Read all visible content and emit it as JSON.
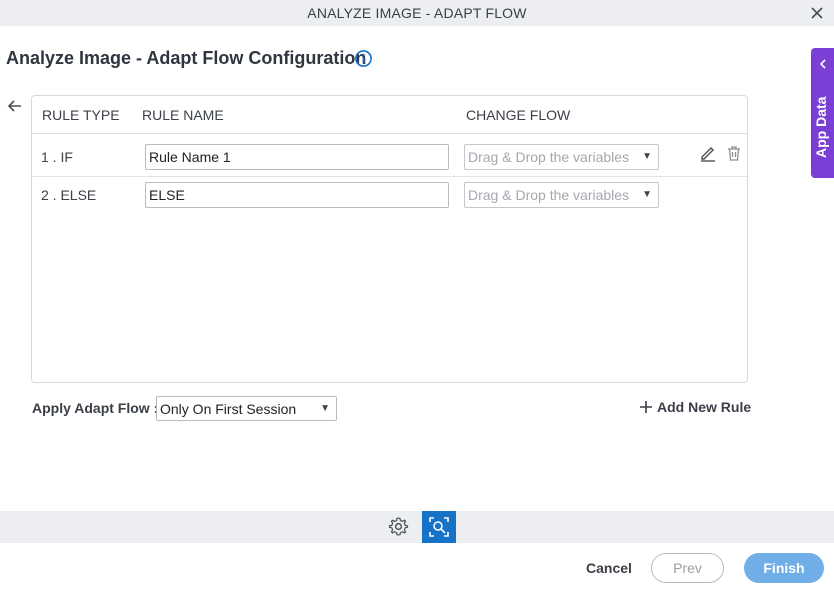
{
  "window": {
    "title": "ANALYZE IMAGE - ADAPT FLOW"
  },
  "page": {
    "title": "Analyze Image - Adapt Flow Configuration"
  },
  "grid": {
    "headers": {
      "rule_type": "RULE TYPE",
      "rule_name": "RULE NAME",
      "change_flow": "CHANGE FLOW"
    },
    "rows": [
      {
        "type": "1 . IF",
        "name": "Rule Name 1",
        "change_flow_placeholder": "Drag & Drop the variables"
      },
      {
        "type": "2 . ELSE",
        "name": "ELSE",
        "change_flow_placeholder": "Drag & Drop the variables"
      }
    ]
  },
  "apply_adapt_flow": {
    "label": "Apply Adapt Flow :",
    "selected": "Only On First Session"
  },
  "add_rule": {
    "label": "Add New Rule"
  },
  "side_panel": {
    "label": "App Data"
  },
  "footer": {
    "cancel": "Cancel",
    "prev": "Prev",
    "finish": "Finish"
  },
  "colors": {
    "accent": "#1673c8",
    "side_tab": "#7b3fd6",
    "finish_button": "#6faee6"
  }
}
